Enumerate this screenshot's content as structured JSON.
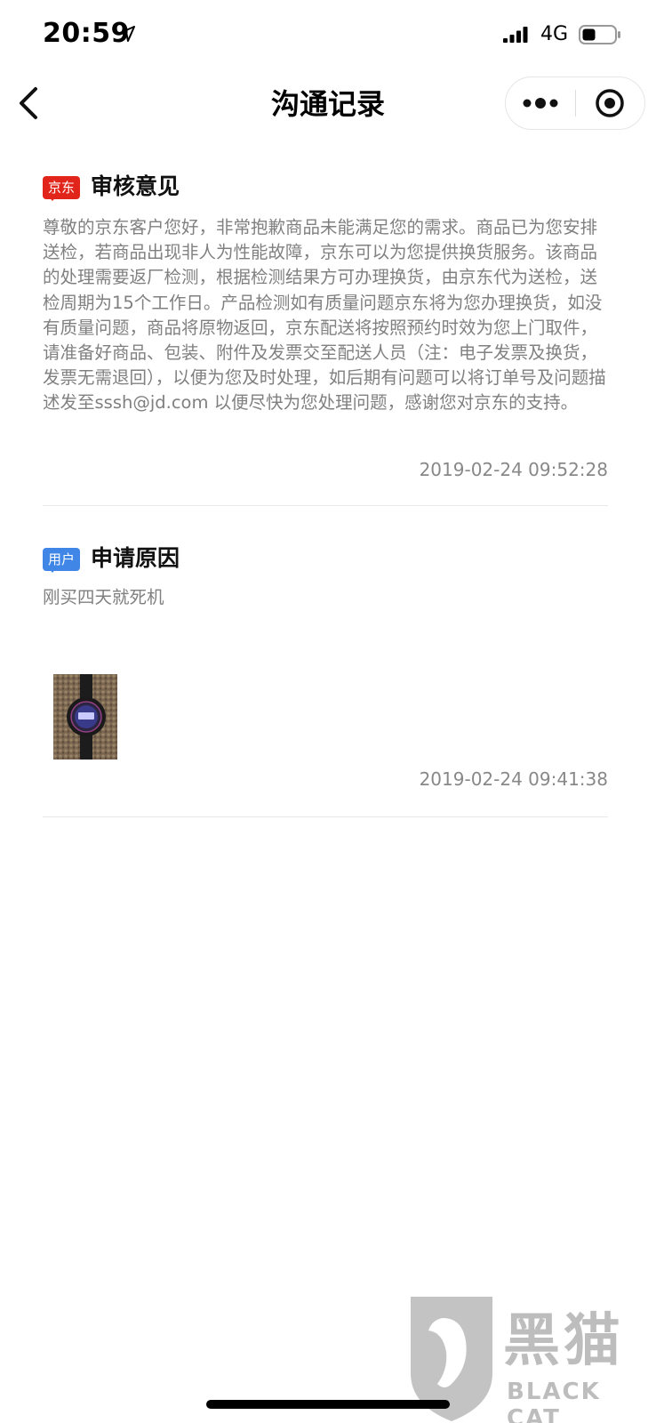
{
  "status_bar": {
    "time": "20:59",
    "network": "4G"
  },
  "nav": {
    "title": "沟通记录"
  },
  "records": [
    {
      "badge": "京东",
      "title": "审核意见",
      "body": "尊敬的京东客户您好，非常抱歉商品未能满足您的需求。商品已为您安排送检，若商品出现非人为性能故障，京东可以为您提供换货服务。该商品的处理需要返厂检测，根据检测结果方可办理换货，由京东代为送检，送检周期为15个工作日。产品检测如有质量问题京东将为您办理换货，如没有质量问题，商品将原物返回，京东配送将按照预约时效为您上门取件，请准备好商品、包装、附件及发票交至配送人员（注：电子发票及换货，发票无需退回），以便为您及时处理，如后期有问题可以将订单号及问题描述发至sssh@jd.com 以便尽快为您处理问题，感谢您对京东的支持。",
      "time": "2019-02-24 09:52:28"
    },
    {
      "badge": "用户",
      "title": "申请原因",
      "body": "刚买四天就死机",
      "time": "2019-02-24 09:41:38"
    }
  ],
  "watermark": {
    "text": "黑猫",
    "sub": "BLACK CAT"
  },
  "colors": {
    "jd_badge": "#e1251b",
    "user_badge": "#3f86e6",
    "body_text": "#808080"
  }
}
